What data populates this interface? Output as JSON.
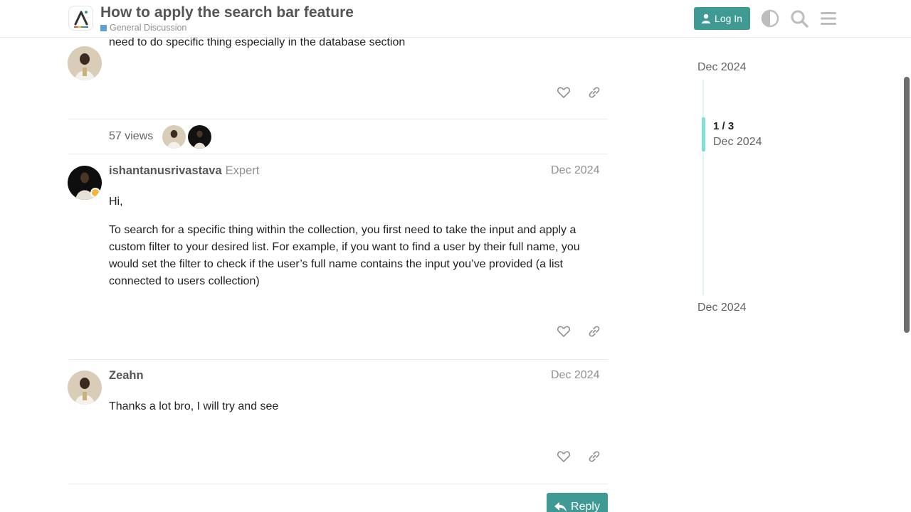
{
  "header": {
    "topic_title": "How to apply the search bar feature",
    "category": "General Discussion",
    "category_color": "#5fa0d6",
    "login_label": "Log In",
    "icons": [
      "theme-toggle-icon",
      "search-icon",
      "hamburger-menu-icon"
    ],
    "accent_color": "#3e9a92"
  },
  "post1": {
    "text_tail": "need to do specific thing especially in the database section",
    "views": "57 views"
  },
  "post2": {
    "username": "ishantanusrivastava",
    "user_title": "Expert",
    "date": "Dec 2024",
    "paragraphs": [
      "Hi,",
      "To search for a specific thing within the collection, you first need to take the input and apply a custom filter to your desired list. For example, if you want to find a user by their full name, you would set the filter to check if the user’s full name contains the input you’ve provided (a list connected to users collection)"
    ]
  },
  "post3": {
    "username": "Zeahn",
    "date": "Dec 2024",
    "text": "Thanks a lot bro, I will try and see"
  },
  "reply_label": "Reply",
  "timeline": {
    "start_date": "Dec 2024",
    "position": "1 / 3",
    "current_date": "Dec 2024",
    "end_date": "Dec 2024"
  }
}
